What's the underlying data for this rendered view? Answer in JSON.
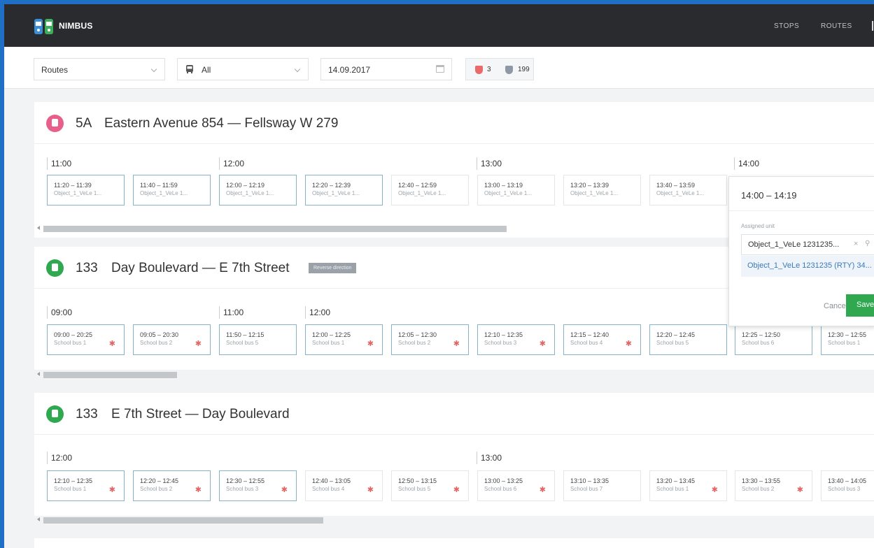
{
  "app": {
    "name": "NIMBUS"
  },
  "nav": {
    "stops": "STOPS",
    "routes": "ROUTES"
  },
  "filters": {
    "type_value": "Routes",
    "vehicle_value": "All",
    "date_value": "14.09.2017",
    "alert_count": "3",
    "ok_count": "199"
  },
  "colors": {
    "topbar": "#2a2b2e",
    "route_pink": "#e8608a",
    "route_green": "#2fa84f",
    "save_green": "#2fa84f",
    "active_border": "#87b3c9"
  },
  "routes": [
    {
      "number": "5A",
      "name": "Eastern Avenue 854 — Fellsway W 279",
      "icon": "bus-icon",
      "hours": [
        "11:00",
        "12:00",
        "13:00",
        "14:00"
      ],
      "trips": [
        {
          "time": "11:20 – 11:39",
          "unit": "Object_1_VeLe 1..."
        },
        {
          "time": "11:40 – 11:59",
          "unit": "Object_1_VeLe 1..."
        },
        {
          "time": "12:00 – 12:19",
          "unit": "Object_1_VeLe 1..."
        },
        {
          "time": "12:20 – 12:39",
          "unit": "Object_1_VeLe 1..."
        },
        {
          "time": "12:40 – 12:59",
          "unit": "Object_1_VeLe 1..."
        },
        {
          "time": "13:00 – 13:19",
          "unit": "Object_1_VeLe 1..."
        },
        {
          "time": "13:20 – 13:39",
          "unit": "Object_1_VeLe 1..."
        },
        {
          "time": "13:40 – 13:59",
          "unit": "Object_1_VeLe 1..."
        }
      ]
    },
    {
      "number": "133",
      "name": "Day Boulevard — E 7th Street",
      "badge": "Reverse direction",
      "icon": "bus-icon",
      "hours": [
        "09:00",
        "11:00",
        "12:00"
      ],
      "trips": [
        {
          "time": "09:00 – 20:25",
          "unit": "School bus 1",
          "star": "✱"
        },
        {
          "time": "09:05 – 20:30",
          "unit": "School bus 2",
          "star": "✱"
        },
        {
          "time": "11:50 – 12:15",
          "unit": "School bus 5",
          "star": ""
        },
        {
          "time": "12:00 – 12:25",
          "unit": "School bus 1",
          "star": "✱"
        },
        {
          "time": "12:05 – 12:30",
          "unit": "School bus 2",
          "star": "✱"
        },
        {
          "time": "12:10 – 12:35",
          "unit": "School bus 3",
          "star": "✱"
        },
        {
          "time": "12:15 – 12:40",
          "unit": "School bus 4",
          "star": "✱"
        },
        {
          "time": "12:20 – 12:45",
          "unit": "School bus 5",
          "star": ""
        },
        {
          "time": "12:25 – 12:50",
          "unit": "School bus 6",
          "star": ""
        },
        {
          "time": "12:30 – 12:55",
          "unit": "School bus 1",
          "star": ""
        }
      ]
    },
    {
      "number": "133",
      "name": "E 7th Street — Day Boulevard",
      "icon": "bus-icon",
      "hours": [
        "12:00",
        "13:00"
      ],
      "trips": [
        {
          "time": "12:10 – 12:35",
          "unit": "School bus 1",
          "star": "✱"
        },
        {
          "time": "12:20 – 12:45",
          "unit": "School bus 2",
          "star": "✱"
        },
        {
          "time": "12:30 – 12:55",
          "unit": "School bus 3",
          "star": "✱"
        },
        {
          "time": "12:40 – 13:05",
          "unit": "School bus 4",
          "star": "✱"
        },
        {
          "time": "12:50 – 13:15",
          "unit": "School bus 5",
          "star": "✱"
        },
        {
          "time": "13:00 – 13:25",
          "unit": "School bus 6",
          "star": "✱"
        },
        {
          "time": "13:10 – 13:35",
          "unit": "School bus 7",
          "star": ""
        },
        {
          "time": "13:20 – 13:45",
          "unit": "School bus 1",
          "star": "✱"
        },
        {
          "time": "13:30 – 13:55",
          "unit": "School bus 2",
          "star": "✱"
        },
        {
          "time": "13:40 – 14:05",
          "unit": "School bus 3",
          "star": ""
        }
      ]
    }
  ],
  "popup": {
    "title": "14:00 – 14:19",
    "label": "Assigned unit",
    "input_value": "Object_1_VeLe 1231235...",
    "option": "Object_1_VeLe 1231235 (RTY) 34...",
    "cancel": "Cancel",
    "save": "Save"
  }
}
